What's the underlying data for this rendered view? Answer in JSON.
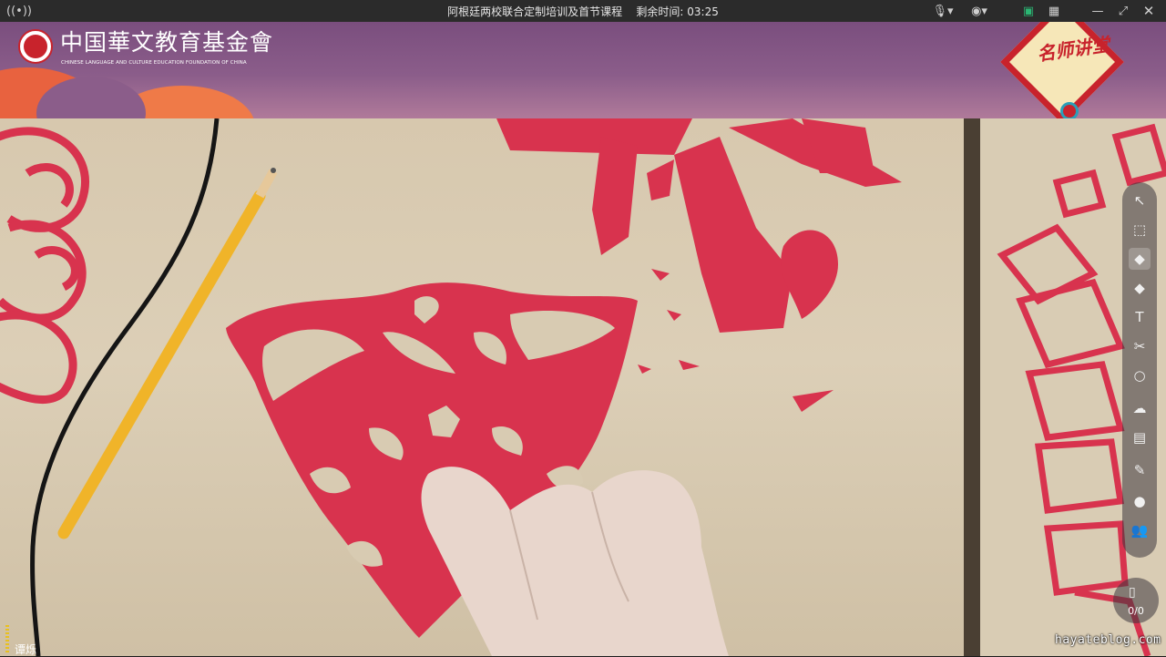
{
  "window": {
    "title": "阿根廷两校联合定制培训及首节课程",
    "remaining_label": "剩余时间:",
    "remaining_time": "03:25"
  },
  "banner": {
    "org_name_cn": "中国華文教育基金會",
    "org_name_en": "CHINESE LANGUAGE AND CULTURE EDUCATION FOUNDATION OF CHINA",
    "badge_text": "名师讲堂"
  },
  "toolbar": {
    "tools": [
      "select",
      "marquee-select",
      "eraser",
      "pen",
      "text",
      "scissors",
      "shape",
      "cloud",
      "toolbox",
      "edit",
      "chat",
      "users"
    ],
    "active_tool": "eraser"
  },
  "counter": {
    "value": "0/0"
  },
  "speaker": {
    "name": "谭烁"
  },
  "watermark": "hayateblog.com",
  "colors": {
    "paper_red": "#d8334e",
    "table": "#d8cbb2",
    "banner": "#7e5382",
    "accent_red": "#c8232c"
  }
}
